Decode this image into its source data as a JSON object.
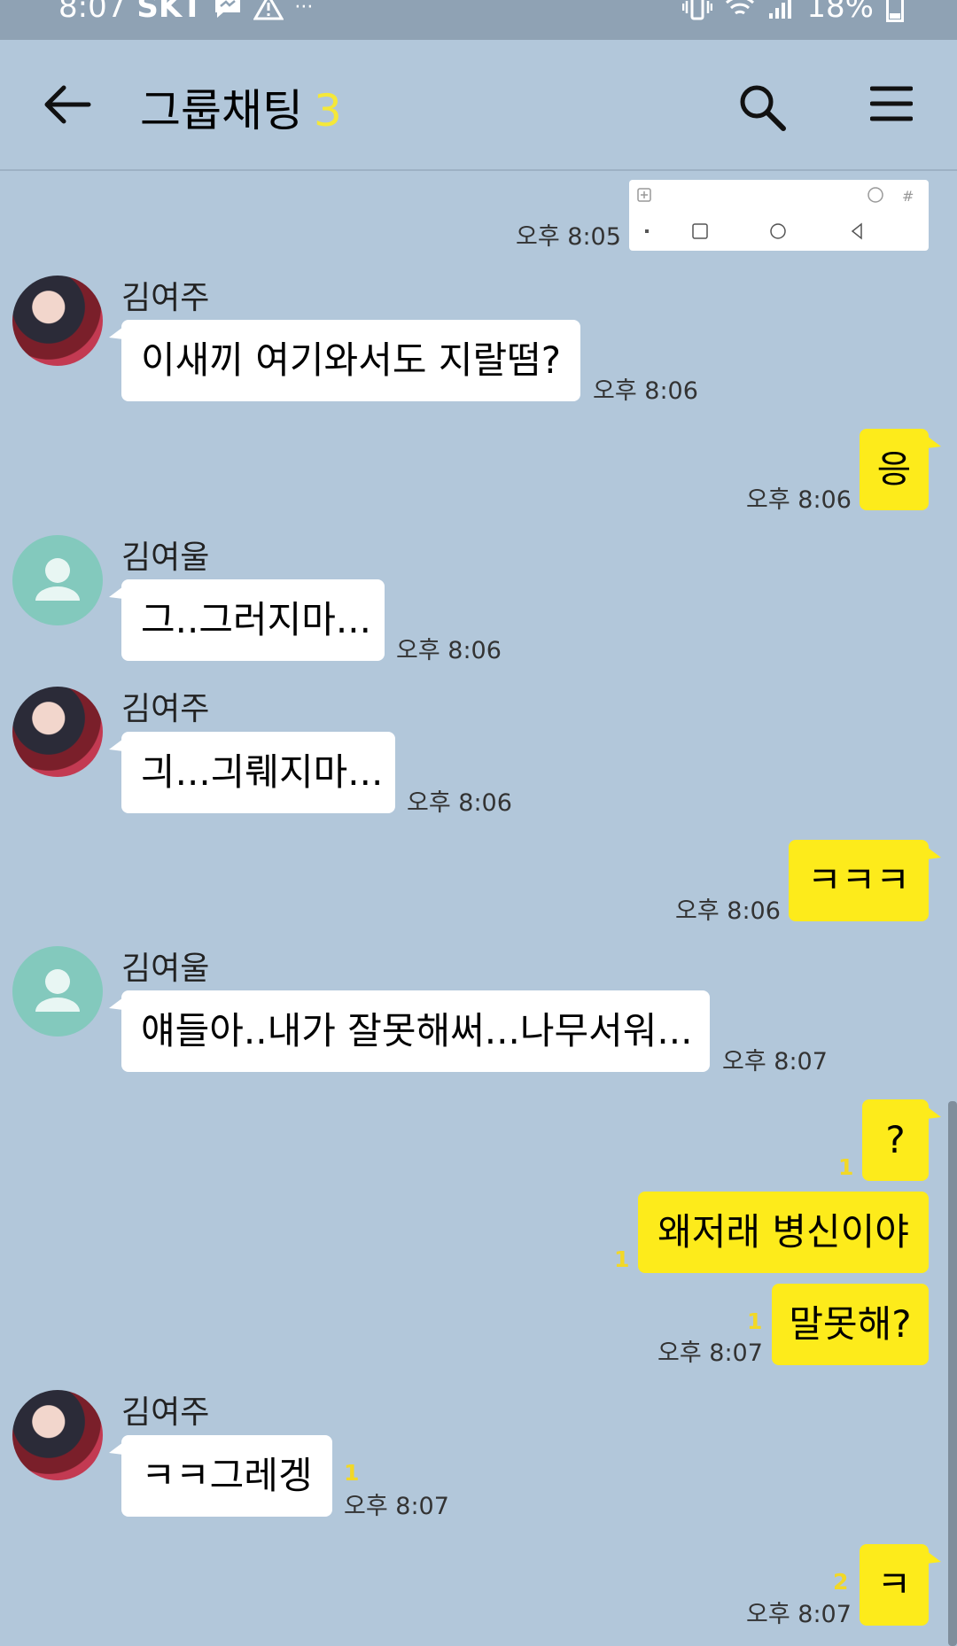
{
  "status_bar": {
    "time": "8:07",
    "carrier": "SKT",
    "battery": "18%",
    "icons": [
      "messenger-icon",
      "warning-icon",
      "more-icon",
      "vibrate-icon",
      "wifi-icon",
      "signal-icon",
      "battery-icon"
    ]
  },
  "header": {
    "title": "그룹채팅",
    "member_count": "3",
    "icons": [
      "back-arrow-icon",
      "search-icon",
      "menu-icon"
    ]
  },
  "colors": {
    "background": "#b2c7da",
    "outgoing_bubble": "#fdeb1b",
    "incoming_bubble": "#ffffff",
    "member_count": "#f5e839",
    "unread": "#f2d827"
  },
  "messages": [
    {
      "time": "오후 8:05"
    },
    {
      "sender": "김여주",
      "text": "이새끼 여기와서도 지랄떰?",
      "time": "오후 8:06"
    },
    {
      "text": "응",
      "time": "오후 8:06"
    },
    {
      "sender": "김여울",
      "text": "그..그러지마...",
      "time": "오후 8:06"
    },
    {
      "sender": "김여주",
      "text": "긔...긔뤠지마...",
      "time": "오후 8:06"
    },
    {
      "text": "ㅋㅋㅋ",
      "time": "오후 8:06"
    },
    {
      "sender": "김여울",
      "text": "얘들아..내가 잘못해써...나무서워...",
      "time": "오후 8:07"
    },
    {
      "text": "?",
      "unread": "1"
    },
    {
      "text": "왜저래 병신이야",
      "unread": "1"
    },
    {
      "text": "말못해?",
      "unread": "1",
      "time": "오후 8:07"
    },
    {
      "sender": "김여주",
      "text": "ㅋㅋ그레겡",
      "unread": "1",
      "time": "오후 8:07"
    },
    {
      "text": "ㅋ",
      "unread": "2",
      "time": "오후 8:07"
    }
  ]
}
